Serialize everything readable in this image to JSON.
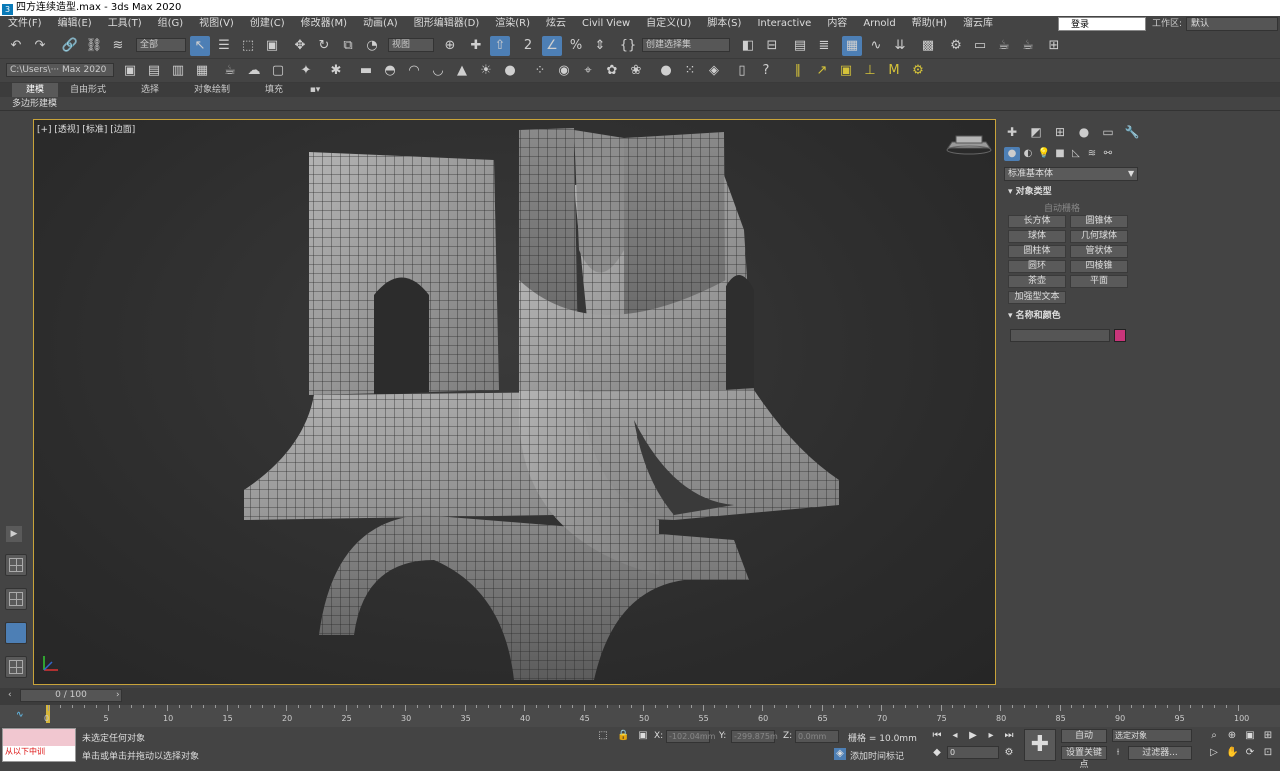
{
  "window": {
    "title": "四方连续造型.max - 3ds Max 2020"
  },
  "menu": [
    "文件(F)",
    "编辑(E)",
    "工具(T)",
    "组(G)",
    "视图(V)",
    "创建(C)",
    "修改器(M)",
    "动画(A)",
    "图形编辑器(D)",
    "渲染(R)",
    "炫云",
    "Civil View",
    "自定义(U)",
    "脚本(S)",
    "Interactive",
    "内容",
    "Arnold",
    "帮助(H)",
    "溜云库"
  ],
  "login": "登录",
  "workspace": {
    "label": "工作区:",
    "value": "默认"
  },
  "toolbar": {
    "filter_value": "全部",
    "refcoord_value": "视图",
    "selection_set": "创建选择集",
    "path_value": "C:\\Users\\··· Max 2020"
  },
  "ribbon": {
    "tabs": [
      "建模",
      "自由形式",
      "选择",
      "对象绘制",
      "填充"
    ],
    "panel_label": "多边形建模"
  },
  "viewport": {
    "label": "[+] [透视] [标准] [边面]"
  },
  "command_panel": {
    "category": "标准基本体",
    "rollout_object_type": "对象类型",
    "autogrid": "自动栅格",
    "objects": [
      "长方体",
      "圆锥体",
      "球体",
      "几何球体",
      "圆柱体",
      "管状体",
      "圆环",
      "四棱锥",
      "茶壶",
      "平面",
      "加强型文本"
    ],
    "rollout_name_color": "名称和颜色",
    "object_color": "#c8357a"
  },
  "timeline": {
    "frame_display": "0 / 100",
    "ticks": [
      "0",
      "5",
      "10",
      "15",
      "20",
      "25",
      "30",
      "35",
      "40",
      "45",
      "50",
      "55",
      "60",
      "65",
      "70",
      "75",
      "80",
      "85",
      "90",
      "95",
      "100"
    ]
  },
  "status": {
    "maxscript_text": "从以下中训",
    "selection_text": "未选定任何对象",
    "prompt_text": "单击或单击并拖动以选择对象",
    "x_label": "X:",
    "x_value": "-102.04mm",
    "y_label": "Y:",
    "y_value": "-299.875m",
    "z_label": "Z:",
    "z_value": "0.0mm",
    "grid": "栅格 = 10.0mm",
    "add_time_tag": "添加时间标记",
    "auto_key": "自动",
    "set_key": "设置关键点",
    "key_filter_value": "选定对象",
    "key_filters": "过滤器...",
    "current_frame": "0"
  }
}
